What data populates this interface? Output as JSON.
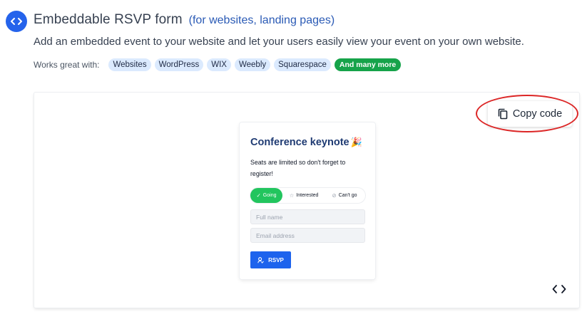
{
  "header": {
    "icon": "code-icon",
    "title": "Embeddable RSVP form",
    "subtitle": "(for websites, landing pages)",
    "description": "Add an embedded event to your website and let your users easily view your event on your own website."
  },
  "works_with": {
    "label": "Works great with:",
    "tags": [
      "Websites",
      "WordPress",
      "WIX",
      "Weebly",
      "Squarespace"
    ],
    "more_label": "And many more"
  },
  "copy_button": {
    "label": "Copy code",
    "icon": "copy-icon"
  },
  "annotation": {
    "ring_color": "#dc2626"
  },
  "form_card": {
    "title": "Conference keynote",
    "title_emoji": "🎉",
    "description": "Seats are limited so don't forget to register!",
    "options": [
      {
        "label": "Going",
        "glyph": "✓"
      },
      {
        "label": "Interested",
        "glyph": "☆"
      },
      {
        "label": "Can't go",
        "glyph": "⊘"
      }
    ],
    "name_placeholder": "Full name",
    "email_placeholder": "Email address",
    "submit_label": "RSVP"
  },
  "colors": {
    "accent": "#2563eb",
    "success": "#16a34a",
    "tag_bg": "#dbeafe"
  }
}
